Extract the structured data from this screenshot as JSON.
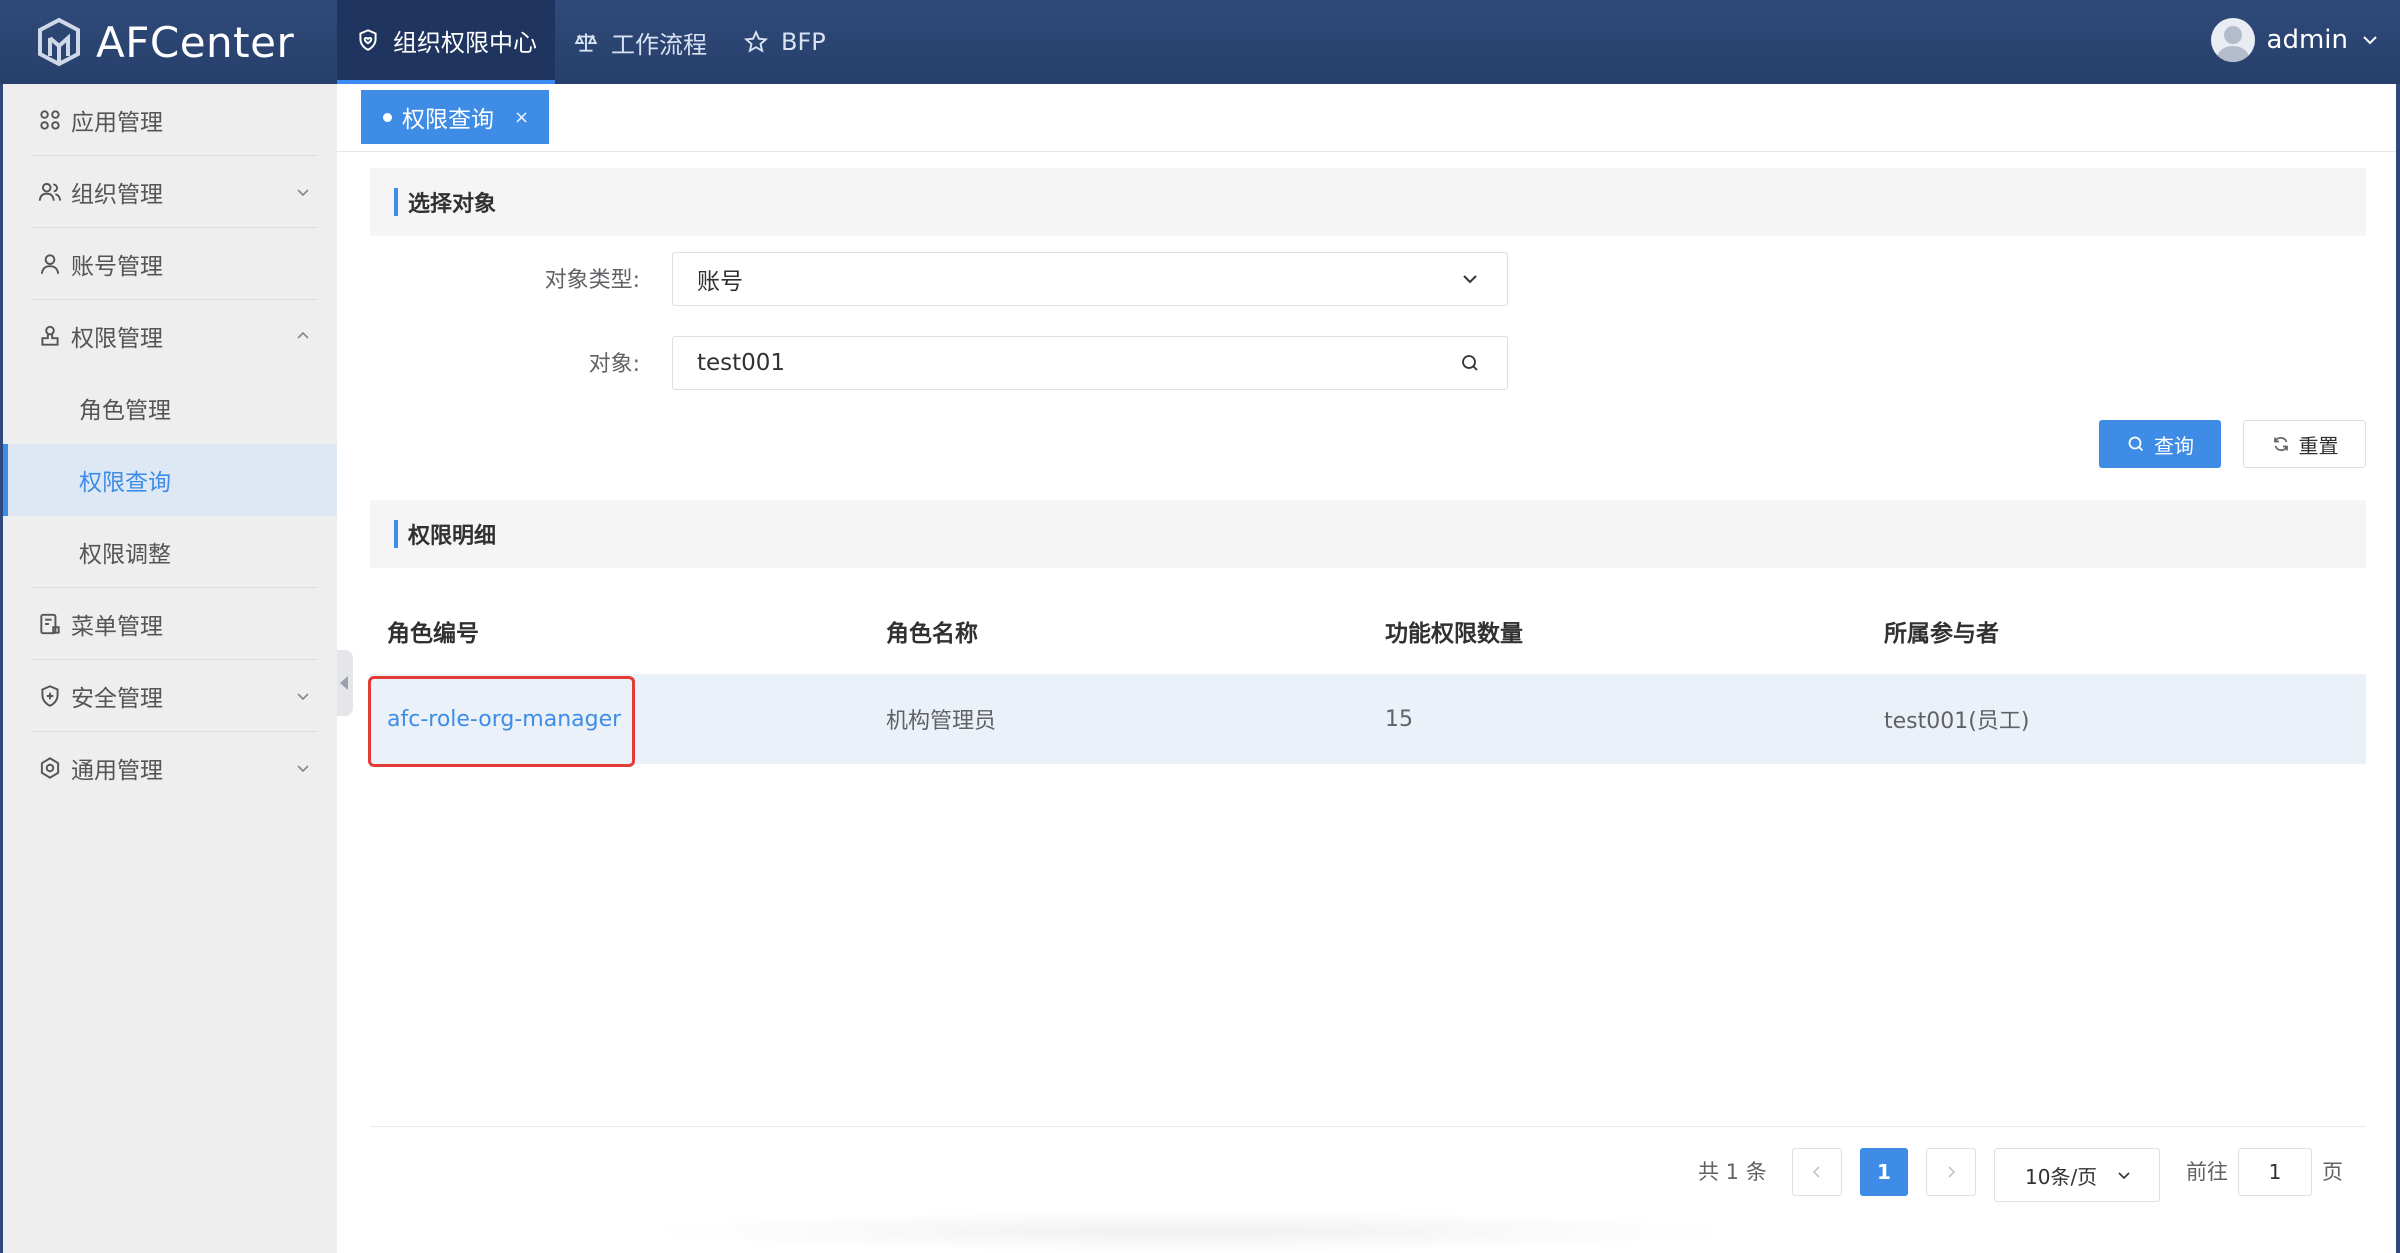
{
  "app": {
    "logo_text": "AFCenter"
  },
  "topnav": [
    {
      "label": "组织权限中心",
      "icon": "shield-heart-icon",
      "active": true
    },
    {
      "label": "工作流程",
      "icon": "scale-icon",
      "active": false
    },
    {
      "label": "BFP",
      "icon": "star-icon",
      "active": false
    }
  ],
  "user": {
    "name": "admin"
  },
  "sidebar": {
    "items": [
      {
        "label": "应用管理",
        "icon": "apps-icon"
      },
      {
        "label": "组织管理",
        "icon": "group-icon"
      },
      {
        "label": "账号管理",
        "icon": "user-icon"
      },
      {
        "label": "权限管理",
        "icon": "permission-icon"
      },
      {
        "label": "菜单管理",
        "icon": "menu-doc-icon"
      },
      {
        "label": "安全管理",
        "icon": "security-icon"
      },
      {
        "label": "通用管理",
        "icon": "settings-icon"
      }
    ],
    "sub_items": [
      {
        "label": "角色管理"
      },
      {
        "label": "权限查询",
        "active": true
      },
      {
        "label": "权限调整"
      }
    ]
  },
  "tabs": [
    {
      "label": "权限查询",
      "close": "×"
    }
  ],
  "select_section": {
    "title": "选择对象"
  },
  "form": {
    "type_label": "对象类型:",
    "type_value": "账号",
    "object_label": "对象:",
    "object_value": "test001"
  },
  "buttons": {
    "query": "查询",
    "reset": "重置"
  },
  "detail_section": {
    "title": "权限明细"
  },
  "table": {
    "headers": [
      "角色编号",
      "角色名称",
      "功能权限数量",
      "所属参与者"
    ],
    "rows": [
      [
        "afc-role-org-manager",
        "机构管理员",
        "15",
        "test001(员工)"
      ]
    ]
  },
  "pagination": {
    "total_text": "共 1 条",
    "current_page": "1",
    "page_size": "10条/页",
    "goto_label": "前往",
    "goto_value": "1",
    "page_suffix": "页"
  },
  "colors": {
    "header_bg": "#2f4a7a",
    "accent": "#3e8ce6",
    "highlight_border": "#e33b35"
  }
}
